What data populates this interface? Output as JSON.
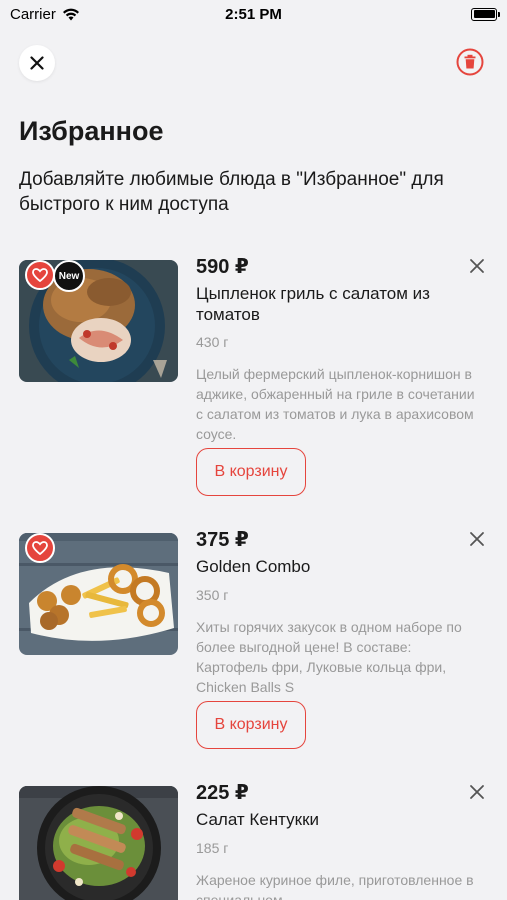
{
  "status": {
    "carrier": "Carrier",
    "time": "2:51 PM"
  },
  "header": {
    "title": "Избранное",
    "subtitle": "Добавляйте любимые блюда в \"Избранное\" для быстрого к ним доступа"
  },
  "items": [
    {
      "price": "590 ₽",
      "name": "Цыпленок гриль с салатом из томатов",
      "weight": "430 г",
      "description": "Целый фермерский цыпленок-корнишон в аджике, обжаренный на гриле в сочетании с салатом из томатов и лука в арахисовом соусе.",
      "badge": "New",
      "cart_label": "В корзину"
    },
    {
      "price": "375 ₽",
      "name": "Golden Combo",
      "weight": "350 г",
      "description": "Хиты горячих закусок в одном наборе по более выгодной цене! В составе: Картофель фри, Луковые кольца фри, Chicken Balls S",
      "cart_label": "В корзину"
    },
    {
      "price": "225 ₽",
      "name": "Салат Кентукки",
      "weight": "185 г",
      "description": "Жареное куриное филе, приготовленное в специальном"
    }
  ],
  "colors": {
    "accent": "#e5453d",
    "background": "#f2f2f4"
  }
}
